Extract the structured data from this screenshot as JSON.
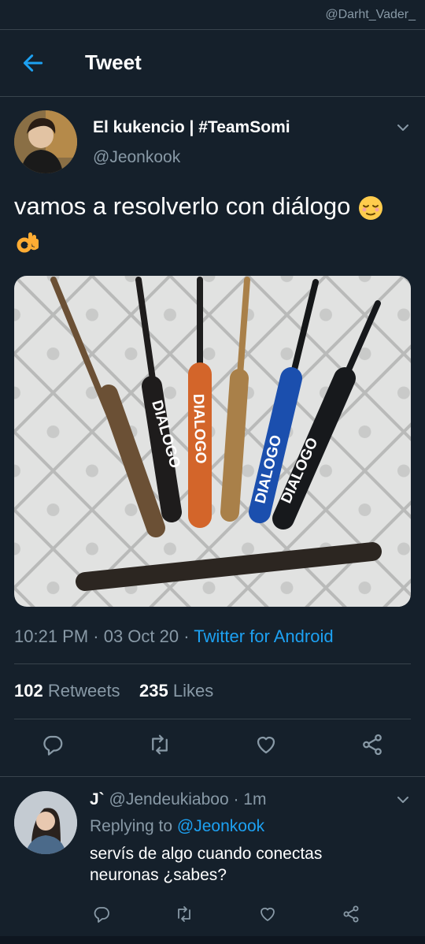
{
  "watermark": "@Darht_Vader_",
  "header": {
    "title": "Tweet"
  },
  "tweet": {
    "display_name": "El kukencio | #TeamSomi",
    "handle": "@Jeonkook",
    "text": "vamos a resolverlo con diálogo",
    "image_text": "DIALOGO",
    "time": "10:21 PM · 03 Oct 20 · ",
    "source": "Twitter for Android",
    "retweets_count": "102",
    "retweets_label": "Retweets",
    "likes_count": "235",
    "likes_label": "Likes"
  },
  "reply": {
    "name": "J`",
    "handle_time": "@Jendeukiaboo · 1m",
    "replying_prefix": "Replying to ",
    "replying_to": "@Jeonkook",
    "text": "servís de algo cuando conectas neuronas ¿sabes?"
  },
  "colors": {
    "background": "#15202b",
    "accent": "#1da1f2",
    "muted": "#8899a6",
    "divider": "#38444d"
  },
  "icons": [
    "back-arrow-icon",
    "chevron-down-icon",
    "reply-icon",
    "retweet-icon",
    "like-icon",
    "share-icon"
  ]
}
